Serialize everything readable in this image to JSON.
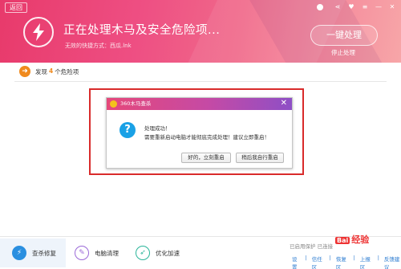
{
  "header": {
    "back_label": "返回",
    "title": "正在处理木马及安全危险项...",
    "subtitle": "无效的快捷方式：西瓜.lnk",
    "onekey_label": "一键处理",
    "stop_label": "停止处理"
  },
  "window_controls": {
    "share": "⋖",
    "skin": "♥",
    "menu": "≡",
    "minimize": "—",
    "close": "✕"
  },
  "found": {
    "prefix": "发现",
    "count": "4",
    "suffix": "个危险项"
  },
  "dialog": {
    "title": "360木马查杀",
    "close": "✕",
    "icon_glyph": "?",
    "line1": "处理成功！",
    "line2": "需要重新启动电脑才能彻底完成处理！建议立即重启！",
    "btn_restart": "好的，立刻重启",
    "btn_later": "稍后我自行重启"
  },
  "tabs": [
    {
      "label": "查杀修复",
      "icon_glyph": "⚡"
    },
    {
      "label": "电脑清理",
      "icon_glyph": "✎"
    },
    {
      "label": "优化加速",
      "icon_glyph": "➶"
    }
  ],
  "footer": {
    "status": "已启用保护 已连接",
    "links": [
      "设置",
      "信任区",
      "恢复区",
      "上报区",
      "反馈建议"
    ]
  },
  "watermark": {
    "badge": "Bai",
    "text": "经验"
  },
  "colors": {
    "accent_orange": "#f08a1e",
    "link_blue": "#2a7bd1",
    "highlight_red": "#d92b2b",
    "question_blue": "#1aa1e6"
  }
}
